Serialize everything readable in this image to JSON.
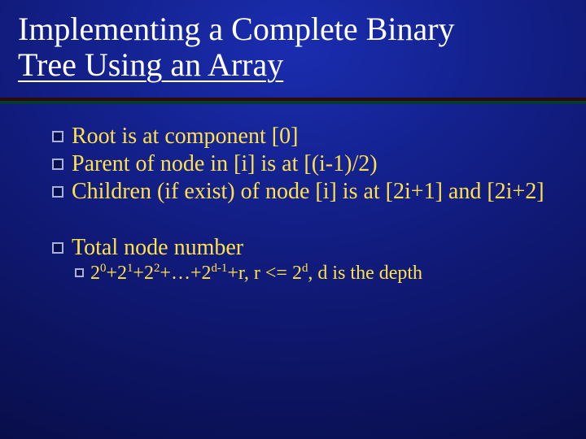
{
  "title": {
    "line1": "Implementing a Complete Binary",
    "line2_underlined": "Tree Using an Array"
  },
  "bullets": [
    {
      "text": "Root is at component [0]"
    },
    {
      "text": "Parent of node in [i] is at [(i-1)/2)"
    },
    {
      "text": "Children (if exist) of node [i] is at [2i+1] and [2i+2]"
    },
    {
      "text": "Total node number"
    }
  ],
  "sub_bullet": {
    "formula_plain": "2^0+2^1+2^2+…+2^(d-1)+r,  r <= 2^d,  d is the depth",
    "parts": {
      "p0": "2",
      "e0": "0",
      "p1": "+2",
      "e1": "1",
      "p2": "+2",
      "e2": "2",
      "p3": "+…+2",
      "e3": "d-1",
      "p4": "+r,  r <= 2",
      "e4": "d",
      "p5": ",  d is the depth"
    }
  }
}
